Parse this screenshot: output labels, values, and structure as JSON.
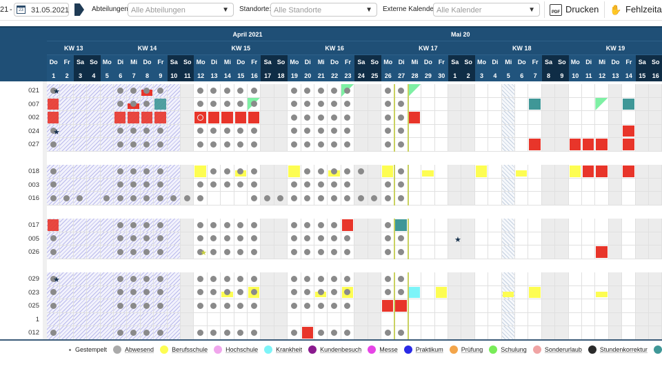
{
  "toolbar": {
    "start_date_fragment": "21",
    "date_separator": "-",
    "end_date": "31.05.2021",
    "departments_label": "Abteilungen:",
    "departments_value": "Alle Abteilungen",
    "locations_label": "Standorte:",
    "locations_value": "Alle Standorte",
    "external_calendar_label": "Externe Kalender:",
    "external_calendar_value": "Alle Kalender",
    "print_label": "Drucken",
    "absence_label": "Fehlzeita"
  },
  "header": {
    "months": [
      {
        "label": "April 2021"
      },
      {
        "label": "Mai 20"
      }
    ],
    "weeks": [
      {
        "label": "KW 13"
      },
      {
        "label": "KW 14"
      },
      {
        "label": "KW 15"
      },
      {
        "label": "KW 16"
      },
      {
        "label": "KW 17"
      },
      {
        "label": "KW 18"
      },
      {
        "label": "KW 19"
      }
    ],
    "days": [
      {
        "dn": "Do",
        "d": "1"
      },
      {
        "dn": "Fr",
        "d": "2"
      },
      {
        "dn": "Sa",
        "d": "3"
      },
      {
        "dn": "So",
        "d": "4"
      },
      {
        "dn": "Mo",
        "d": "5"
      },
      {
        "dn": "Di",
        "d": "6"
      },
      {
        "dn": "Mi",
        "d": "7"
      },
      {
        "dn": "Do",
        "d": "8"
      },
      {
        "dn": "Fr",
        "d": "9"
      },
      {
        "dn": "Sa",
        "d": "10"
      },
      {
        "dn": "So",
        "d": "11"
      },
      {
        "dn": "Mo",
        "d": "12"
      },
      {
        "dn": "Di",
        "d": "13"
      },
      {
        "dn": "Mi",
        "d": "14"
      },
      {
        "dn": "Do",
        "d": "15"
      },
      {
        "dn": "Fr",
        "d": "16"
      },
      {
        "dn": "Sa",
        "d": "17"
      },
      {
        "dn": "So",
        "d": "18"
      },
      {
        "dn": "Mo",
        "d": "19"
      },
      {
        "dn": "Di",
        "d": "20"
      },
      {
        "dn": "Mi",
        "d": "21"
      },
      {
        "dn": "Do",
        "d": "22"
      },
      {
        "dn": "Fr",
        "d": "23"
      },
      {
        "dn": "Sa",
        "d": "24"
      },
      {
        "dn": "So",
        "d": "25"
      },
      {
        "dn": "Mo",
        "d": "26"
      },
      {
        "dn": "Di",
        "d": "27"
      },
      {
        "dn": "Mi",
        "d": "28"
      },
      {
        "dn": "Do",
        "d": "29"
      },
      {
        "dn": "Fr",
        "d": "30"
      },
      {
        "dn": "Sa",
        "d": "1"
      },
      {
        "dn": "So",
        "d": "2"
      },
      {
        "dn": "Mo",
        "d": "3"
      },
      {
        "dn": "Di",
        "d": "4"
      },
      {
        "dn": "Mi",
        "d": "5"
      },
      {
        "dn": "Do",
        "d": "6"
      },
      {
        "dn": "Fr",
        "d": "7"
      },
      {
        "dn": "Sa",
        "d": "8"
      },
      {
        "dn": "So",
        "d": "9"
      },
      {
        "dn": "Mo",
        "d": "10"
      },
      {
        "dn": "Di",
        "d": "11"
      },
      {
        "dn": "Mi",
        "d": "12"
      },
      {
        "dn": "Do",
        "d": "13"
      },
      {
        "dn": "Fr",
        "d": "14"
      },
      {
        "dn": "Sa",
        "d": "15"
      },
      {
        "dn": "So",
        "d": "16"
      }
    ],
    "today": "27"
  },
  "cell_legend": {
    ".": "empty",
    "o": "Abwesend dot",
    "*": "dot + Gestempelt star",
    "S": "Gestempelt star",
    "k": "dot + yellow star",
    "R": "red absence",
    "P": "red absence with dot",
    "r": "partial red with dot",
    "T": "teal",
    "C": "Krankheit",
    "Y": "Berufsschule",
    "Q": "Berufsschule with dot",
    "y": "partial Berufsschule",
    "q": "partial Berufsschule with dot",
    "g": "Schulung corner with dot",
    "G": "Schulung corner"
  },
  "groups": [
    {
      "rows": [
        {
          "label": "021",
          "cells": "*....ooro..ooooo..oooog..ooG..................."
        },
        {
          "label": "007",
          "cells": "R....oroT..oooog..ooooo..oo.........T....G.T.."
        },
        {
          "label": "002",
          "cells": "R....RRRR..PRRRR..ooooo..ooR..................."
        },
        {
          "label": "024",
          "cells": "*....oooo..ooooo..ooooo..oo................R.."
        },
        {
          "label": "027",
          "cells": "o....oooo..ooooo..ooooo..oo.........R..RRR.R.."
        }
      ]
    },
    {
      "rows": [
        {
          "label": "018",
          "cells": "o....oooo..Yooqo..YooqoO.Yo.y...Y..y...YRR.R.."
        },
        {
          "label": "003",
          "cells": "o....oooo..ooooo..ooooo..oo..................."
        },
        {
          "label": "016",
          "cells": "ooo.oooooooo...oooooooooooo..................."
        }
      ]
    },
    {
      "rows": [
        {
          "label": "017",
          "cells": "R....oooo..ooooo..ooooR..oT..................."
        },
        {
          "label": "005",
          "cells": "o....oooo..ooooo..ooooo..oo...S..............."
        },
        {
          "label": "026",
          "cells": "o....oooo..koooo..ooooo..oo..............R...."
        }
      ]
    },
    {
      "rows": [
        {
          "label": "029",
          "cells": "*....oooo..ooooo..ooooo..oo..................."
        },
        {
          "label": "023",
          "cells": "o....oooo..ooqoQ..ooqoQ..ooC.Y....y.Y....y...."
        },
        {
          "label": "025",
          "cells": "o....oooo..ooooo..ooooo..RR..................."
        },
        {
          "label": "1",
          "cells": ".............................................."
        },
        {
          "label": "012",
          "cells": "o....oooo..ooooo..oRooo..oo..................."
        }
      ]
    }
  ],
  "colors": {
    "red": "#e8352a",
    "yellow": "#fdfd52",
    "teal": "#3f9797",
    "cyan": "#7df4f8",
    "green": "#7ef0a4",
    "dot": "#8a8a8a",
    "star": "#17324d",
    "header": "#1f4f76",
    "weekend_header": "#0f2d46",
    "today_line": "#c9d160"
  },
  "legend": [
    {
      "label": "Gestempelt",
      "color": "#777777",
      "small": true
    },
    {
      "label": "Abwesend",
      "color": "#aaaaaa"
    },
    {
      "label": "Berufsschule",
      "color": "#fdfd52"
    },
    {
      "label": "Hochschule",
      "color": "#f0a6ec"
    },
    {
      "label": "Krankheit",
      "color": "#7df4f8"
    },
    {
      "label": "Kundenbesuch",
      "color": "#8a1a8e"
    },
    {
      "label": "Messe",
      "color": "#e644e6"
    },
    {
      "label": "Praktikum",
      "color": "#2a2ae6"
    },
    {
      "label": "Prüfung",
      "color": "#f3a54a"
    },
    {
      "label": "Schulung",
      "color": "#78ec58"
    },
    {
      "label": "Sonderurlaub",
      "color": "#f0a4a4"
    },
    {
      "label": "Stundenkorrektur",
      "color": "#2a2a2a"
    },
    {
      "label": "",
      "color": "#3f9797"
    }
  ]
}
